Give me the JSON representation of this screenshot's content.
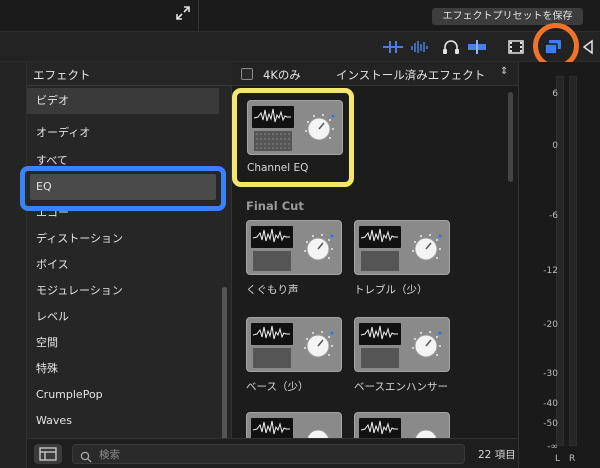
{
  "topbar": {
    "save_preset_label": "エフェクトプリセットを保存"
  },
  "sidebar": {
    "header": "エフェクト",
    "categories": [
      {
        "label": "ビデオ"
      },
      {
        "label": "オーディオ"
      },
      {
        "label": "すべて"
      },
      {
        "label": "EQ"
      },
      {
        "label": "エコー"
      },
      {
        "label": "ディストーション"
      },
      {
        "label": "ボイス"
      },
      {
        "label": "モジュレーション"
      },
      {
        "label": "レベル"
      },
      {
        "label": "空間"
      },
      {
        "label": "特殊"
      },
      {
        "label": "CrumplePop"
      },
      {
        "label": "Waves"
      }
    ],
    "selected": "EQ"
  },
  "grid": {
    "only_4k_label": "4Kのみ",
    "installed_filter_label": "インストール済みエフェクト",
    "installed_chevron": "⌃⌄",
    "top_tiles": [
      {
        "label": "Channel EQ"
      }
    ],
    "section_title": "Final Cut",
    "tiles": [
      {
        "label": "くぐもり声"
      },
      {
        "label": "トレブル（少）"
      },
      {
        "label": "ベース（少）"
      },
      {
        "label": "ベースエンハンサー"
      }
    ]
  },
  "bottombar": {
    "search_placeholder": "検索",
    "item_count": "22 項目"
  },
  "meter": {
    "ticks": [
      "6",
      "0",
      "-6",
      "-12",
      "-20",
      "-30",
      "-40",
      "-50",
      "-∞"
    ],
    "left_label": "L",
    "right_label": "R"
  },
  "colors": {
    "highlight_orange": "#f0732a",
    "highlight_blue": "#3a82f7",
    "highlight_yellow": "#f5e66e",
    "toolbar_accent": "#3d7cf2"
  },
  "icons": [
    "fullscreen-icon",
    "audio-edit-icon",
    "waveform-icon",
    "headphones-icon",
    "audio-lanes-icon",
    "video-filmstrip-icon",
    "browser-toggle-icon",
    "inspector-icon",
    "search-icon",
    "layout-icon"
  ]
}
